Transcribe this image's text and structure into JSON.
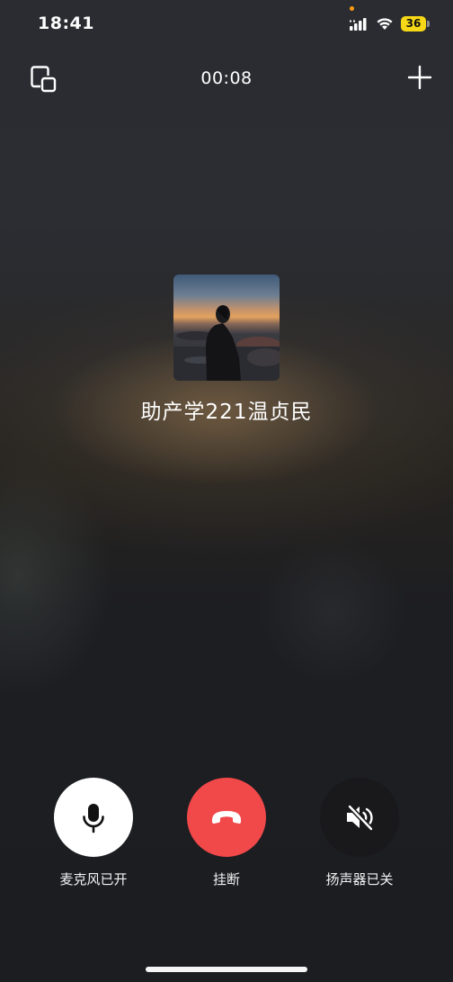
{
  "status_bar": {
    "time": "18:41",
    "battery_level": "36",
    "battery_color": "#f6d816",
    "privacy_dot_color": "#ff9d0a",
    "icons": [
      "signal-icon",
      "wifi-icon",
      "battery-icon"
    ]
  },
  "top_bar": {
    "left_icon": "float-window-icon",
    "call_duration": "00:08",
    "right_icon": "plus-icon"
  },
  "caller": {
    "name": "助产学221温贞民",
    "avatar": "avatar-photo"
  },
  "controls": {
    "mic": {
      "label": "麦克风已开",
      "icon": "microphone-icon",
      "state": "on",
      "bg_color": "#ffffff"
    },
    "hangup": {
      "label": "挂断",
      "icon": "hang-up-icon",
      "bg_color": "#f1484a"
    },
    "speaker": {
      "label": "扬声器已关",
      "icon": "speaker-muted-icon",
      "state": "off",
      "bg_color": "#19191b"
    }
  }
}
